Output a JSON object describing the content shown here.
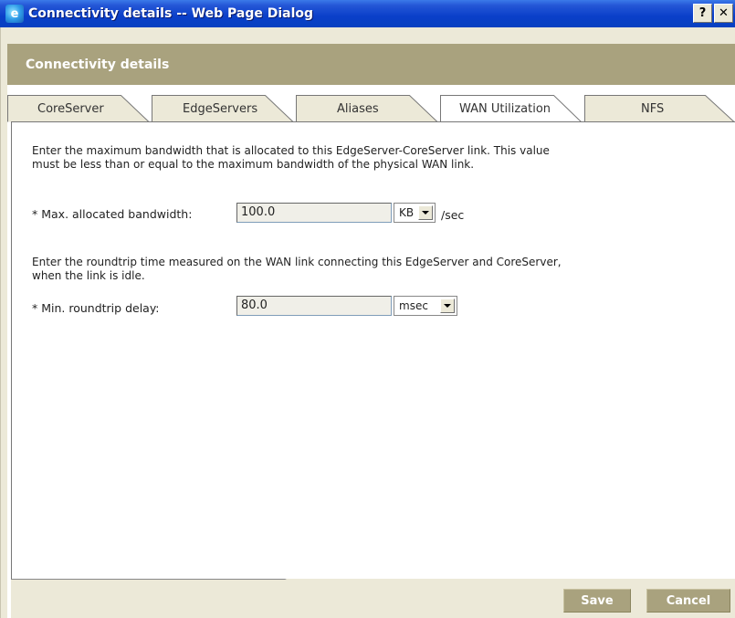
{
  "window": {
    "title": "Connectivity details -- Web Page Dialog",
    "help_glyph": "?",
    "close_glyph": "✕",
    "app_icon": "ie-icon"
  },
  "header": {
    "title": "Connectivity details"
  },
  "tabs": [
    {
      "label": "CoreServer",
      "active": false
    },
    {
      "label": "EdgeServers",
      "active": false
    },
    {
      "label": "Aliases",
      "active": false
    },
    {
      "label": "WAN Utilization",
      "active": true
    },
    {
      "label": "NFS",
      "active": false
    }
  ],
  "bandwidth": {
    "description": "Enter the maximum bandwidth that is allocated to this EdgeServer-CoreServer link. This value must be less than or equal to the maximum bandwidth of the physical WAN link.",
    "label": "* Max. allocated bandwidth:",
    "value": "100.0",
    "unit_selected": "KB",
    "unit_suffix": "/sec"
  },
  "roundtrip": {
    "description": "Enter the roundtrip time measured on the WAN link connecting this EdgeServer and CoreServer, when the link is idle.",
    "label": "* Min. roundtrip delay:",
    "value": "80.0",
    "unit_selected": "msec"
  },
  "footer": {
    "save_label": "Save",
    "cancel_label": "Cancel"
  },
  "colors": {
    "accent": "#a9a27e",
    "titlebar": "#0a3fc9"
  }
}
